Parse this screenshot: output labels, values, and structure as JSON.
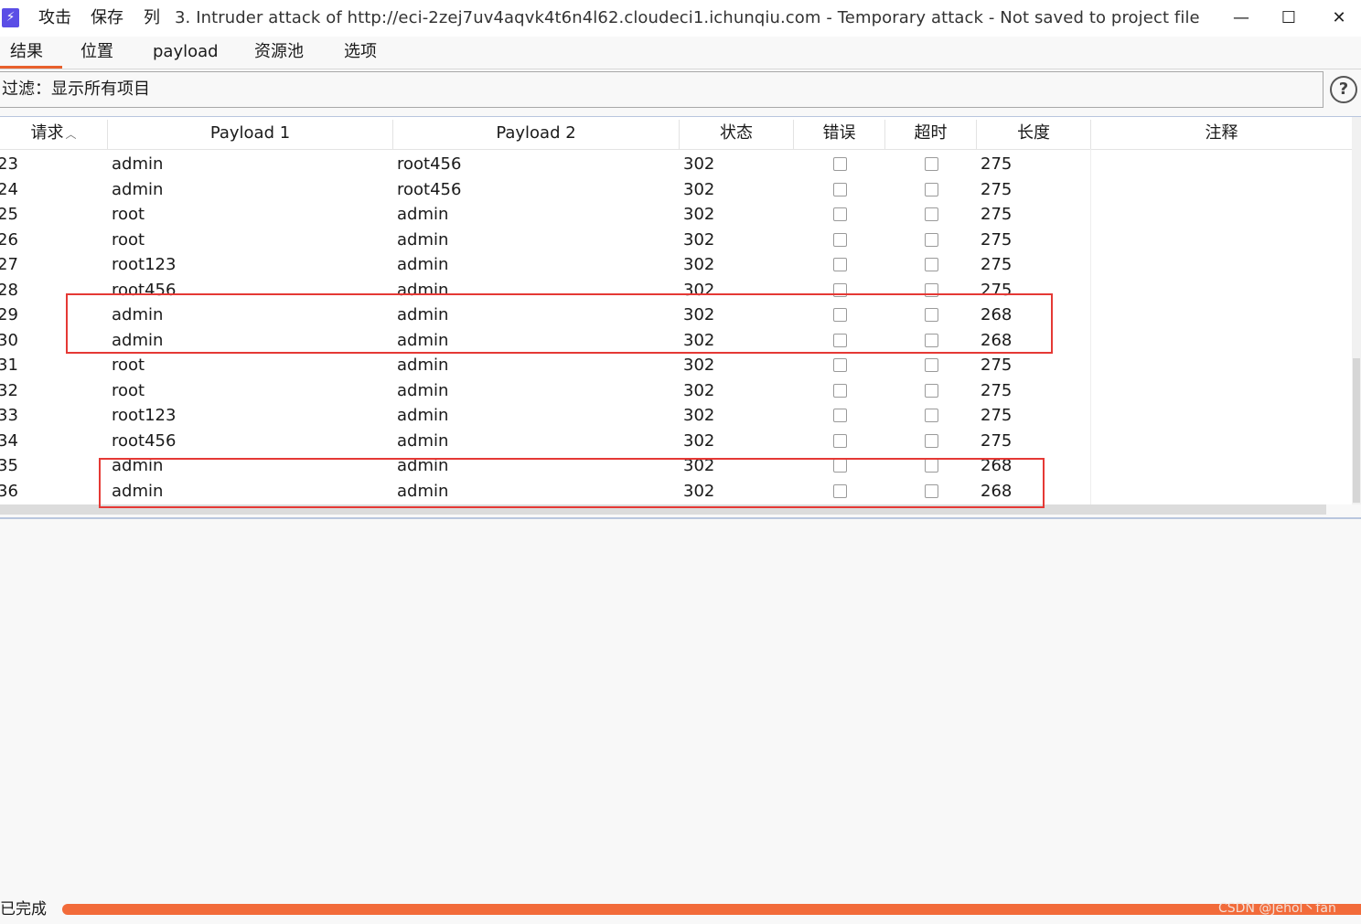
{
  "titlebar": {
    "app_icon": "⚡",
    "menu": [
      "攻击",
      "保存",
      "列"
    ],
    "title": "3. Intruder attack of http://eci-2zej7uv4aqvk4t6n4l62.cloudeci1.ichunqiu.com - Temporary attack - Not saved to project file",
    "minimize": "—",
    "maximize": "☐",
    "close": "✕"
  },
  "tabs": [
    "结果",
    "位置",
    "payload",
    "资源池",
    "选项"
  ],
  "active_tab": "结果",
  "filter": {
    "text": "过滤：显示所有项目"
  },
  "help_icon": "?",
  "table": {
    "columns": [
      "请求",
      "Payload 1",
      "Payload 2",
      "状态",
      "错误",
      "超时",
      "长度",
      "注释"
    ],
    "sort_indicator": "^",
    "rows": [
      {
        "req": "23",
        "p1": "admin",
        "p2": "root456",
        "status": "302",
        "error": false,
        "timeout": false,
        "length": "275",
        "comment": ""
      },
      {
        "req": "24",
        "p1": "admin",
        "p2": "root456",
        "status": "302",
        "error": false,
        "timeout": false,
        "length": "275",
        "comment": ""
      },
      {
        "req": "25",
        "p1": "root",
        "p2": "admin",
        "status": "302",
        "error": false,
        "timeout": false,
        "length": "275",
        "comment": ""
      },
      {
        "req": "26",
        "p1": "root",
        "p2": "admin",
        "status": "302",
        "error": false,
        "timeout": false,
        "length": "275",
        "comment": ""
      },
      {
        "req": "27",
        "p1": "root123",
        "p2": "admin",
        "status": "302",
        "error": false,
        "timeout": false,
        "length": "275",
        "comment": ""
      },
      {
        "req": "28",
        "p1": "root456",
        "p2": "admin",
        "status": "302",
        "error": false,
        "timeout": false,
        "length": "275",
        "comment": ""
      },
      {
        "req": "29",
        "p1": "admin",
        "p2": "admin",
        "status": "302",
        "error": false,
        "timeout": false,
        "length": "268",
        "comment": ""
      },
      {
        "req": "30",
        "p1": "admin",
        "p2": "admin",
        "status": "302",
        "error": false,
        "timeout": false,
        "length": "268",
        "comment": ""
      },
      {
        "req": "31",
        "p1": "root",
        "p2": "admin",
        "status": "302",
        "error": false,
        "timeout": false,
        "length": "275",
        "comment": ""
      },
      {
        "req": "32",
        "p1": "root",
        "p2": "admin",
        "status": "302",
        "error": false,
        "timeout": false,
        "length": "275",
        "comment": ""
      },
      {
        "req": "33",
        "p1": "root123",
        "p2": "admin",
        "status": "302",
        "error": false,
        "timeout": false,
        "length": "275",
        "comment": ""
      },
      {
        "req": "34",
        "p1": "root456",
        "p2": "admin",
        "status": "302",
        "error": false,
        "timeout": false,
        "length": "275",
        "comment": ""
      },
      {
        "req": "35",
        "p1": "admin",
        "p2": "admin",
        "status": "302",
        "error": false,
        "timeout": false,
        "length": "268",
        "comment": ""
      },
      {
        "req": "36",
        "p1": "admin",
        "p2": "admin",
        "status": "302",
        "error": false,
        "timeout": false,
        "length": "268",
        "comment": ""
      }
    ]
  },
  "highlight_color": "#e53935",
  "status": {
    "label": "已完成",
    "progress": 1.0,
    "progress_color": "#f26b3a"
  },
  "watermark": "CSDN @Jehol丶fan"
}
